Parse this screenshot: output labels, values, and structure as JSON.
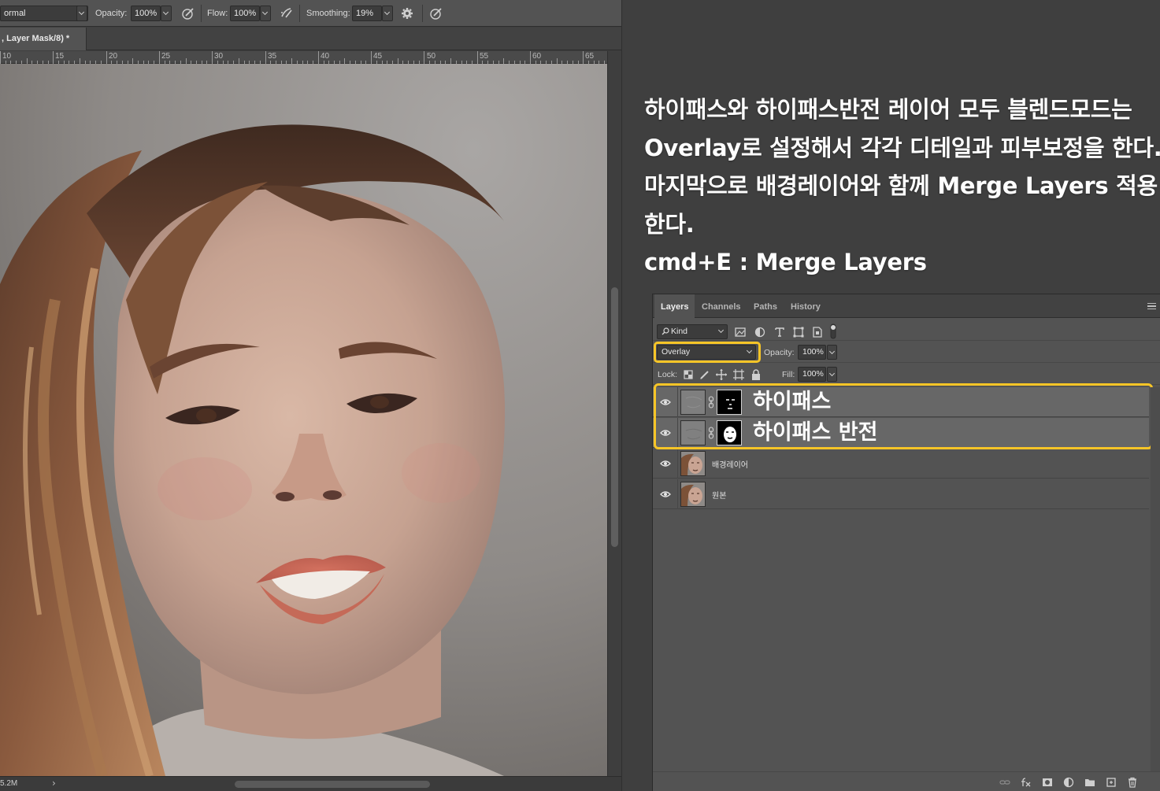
{
  "options_bar": {
    "blend_mode": "ormal",
    "opacity_label": "Opacity:",
    "opacity_value": "100%",
    "flow_label": "Flow:",
    "flow_value": "100%",
    "smoothing_label": "Smoothing:",
    "smoothing_value": "19%"
  },
  "document": {
    "tab_title": ", Layer Mask/8) *",
    "doc_size": "5.2M",
    "status_arrow": "›"
  },
  "ruler": {
    "labels": [
      "10",
      "15",
      "20",
      "25",
      "30",
      "35",
      "40",
      "45",
      "50",
      "55",
      "60",
      "65"
    ]
  },
  "annotation": {
    "lines": [
      "하이패스와 하이패스반전 레이어 모두 블렌드모드는",
      "Overlay로 설정해서 각각 디테일과 피부보정을 한다.",
      "마지막으로 배경레이어와 함께 Merge Layers 적용",
      "한다.",
      "cmd+E : Merge Layers"
    ]
  },
  "layers_panel": {
    "tabs": [
      "Layers",
      "Channels",
      "Paths",
      "History"
    ],
    "filter_kind": "Kind",
    "blend_mode": "Overlay",
    "opacity_label": "Opacity:",
    "opacity_value": "100%",
    "lock_label": "Lock:",
    "fill_label": "Fill:",
    "fill_value": "100%",
    "layers": [
      {
        "name": "하이패스"
      },
      {
        "name": "하이패스 반전"
      },
      {
        "name": "배경레이어"
      },
      {
        "name": "원본"
      }
    ]
  },
  "colors": {
    "highlight": "#f7c527",
    "panel_bg": "#535353",
    "workspace_bg": "#3f3f3f"
  },
  "icons": [
    "brush-pressure-icon",
    "airbrush-icon",
    "gear-icon",
    "symmetry-icon",
    "search-icon",
    "eye-icon",
    "chain-icon",
    "lock-icon",
    "panel-menu-icon",
    "link-icon",
    "fx-icon",
    "mask-icon",
    "adjustment-icon",
    "folder-icon",
    "new-layer-icon",
    "trash-icon"
  ]
}
